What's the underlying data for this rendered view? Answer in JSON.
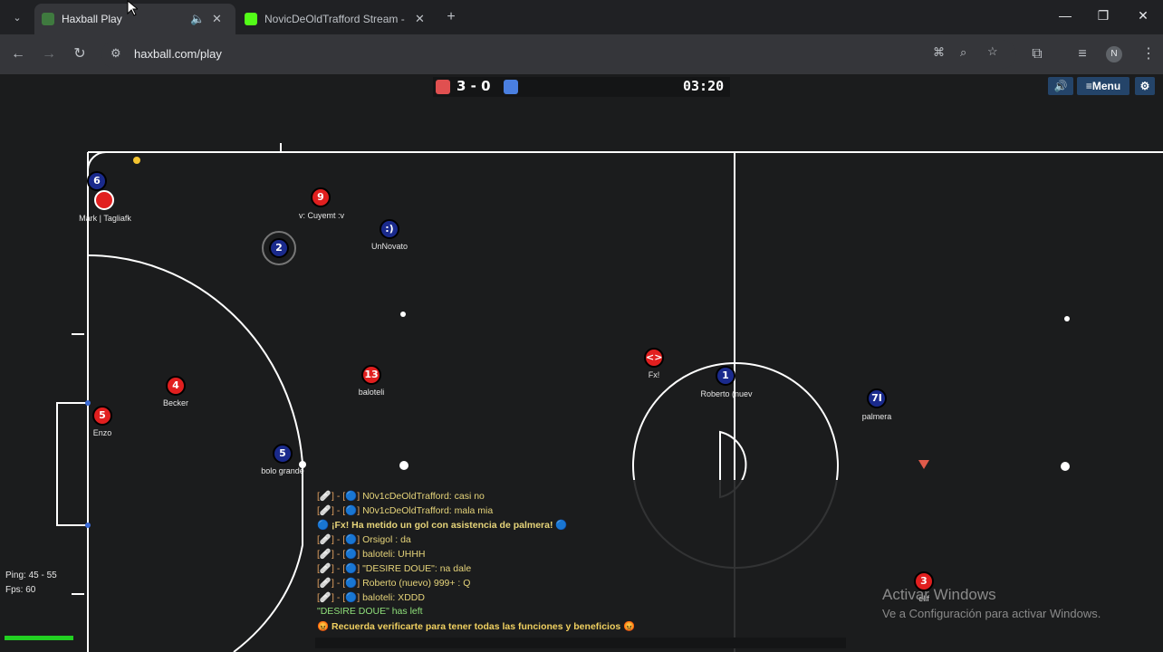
{
  "browser": {
    "tabs": [
      {
        "title": "Haxball Play",
        "active": true
      },
      {
        "title": "NovicDeOldTrafford Stream - W",
        "active": false
      }
    ],
    "url": "haxball.com/play",
    "profile_initial": "N"
  },
  "game": {
    "score": "3 - 0",
    "timer": "03:20",
    "buttons": {
      "sound": "🔊",
      "menu": "≡Menu",
      "settings": "⚙"
    },
    "colors": {
      "red_team": "#e11f1f",
      "blue_team": "#1a2a8c",
      "field": "#1b1c1d",
      "lines": "#ffffff"
    },
    "players": [
      {
        "number": "6",
        "team": "blue",
        "name": ""
      },
      {
        "number": "",
        "team": "red",
        "name": "Mark | Tagliafk"
      },
      {
        "number": "9",
        "team": "red",
        "name": "v: Cuyemt :v"
      },
      {
        "number": ":)",
        "team": "blue",
        "name": "UnNovato"
      },
      {
        "number": "2",
        "team": "blue",
        "name": ""
      },
      {
        "number": "4",
        "team": "red",
        "name": "Becker"
      },
      {
        "number": "13",
        "team": "red",
        "name": "baloteli"
      },
      {
        "number": "<>",
        "team": "red",
        "name": "Fx!"
      },
      {
        "number": "1",
        "team": "blue",
        "name": "Roberto (nuev"
      },
      {
        "number": "7I",
        "team": "blue",
        "name": "palmera"
      },
      {
        "number": "5",
        "team": "red",
        "name": "Enzo"
      },
      {
        "number": "5",
        "team": "blue",
        "name": "bolo grande"
      },
      {
        "number": "3",
        "team": "red",
        "name": "elif"
      }
    ],
    "chat": [
      {
        "prefix": "[🩹] - [🔵]",
        "text": "N0v1cDeOldTrafford: casi no"
      },
      {
        "prefix": "[🩹] - [🔵]",
        "text": "N0v1cDeOldTrafford: mala mia"
      },
      {
        "prefix": "🔵",
        "text": "¡Fx! Ha metido un gol con asistencia de palmera! 🔵"
      },
      {
        "prefix": "[🩹] - [🔵]",
        "text": "Orsigol : da"
      },
      {
        "prefix": "[🩹] - [🔵]",
        "text": "baloteli: UHHH"
      },
      {
        "prefix": "[🩹] - [🔵]",
        "text": "\"DESIRE DOUE\": na dale"
      },
      {
        "prefix": "[🩹] - [🔵]",
        "text": "Roberto (nuevo) 999+ : Q"
      },
      {
        "prefix": "[🩹] - [🔵]",
        "text": "baloteli: XDDD"
      },
      {
        "prefix": "",
        "text": "\"DESIRE DOUE\" has left"
      },
      {
        "prefix": "😡",
        "text": "Recuerda verificarte para tener todas las funciones y beneficios 😡"
      }
    ],
    "ping": "Ping: 45 - 55",
    "fps": "Fps: 60"
  },
  "windows_watermark": {
    "line1": "Activar Windows",
    "line2": "Ve a Configuración para activar Windows."
  }
}
